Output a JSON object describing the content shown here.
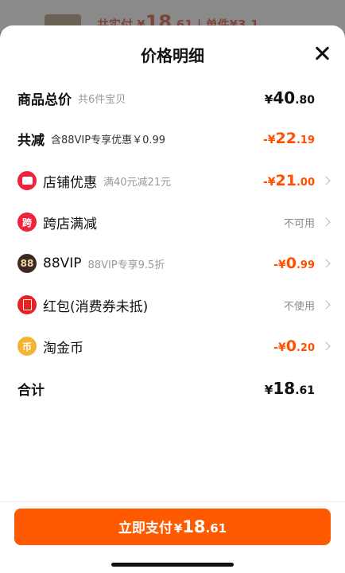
{
  "background": {
    "text_prefix": "共实付",
    "price_cur": "¥",
    "price_int": "18",
    "price_dec": ".61",
    "text_suffix": "| 单件¥3.1"
  },
  "sheet": {
    "title": "价格明细"
  },
  "rows": {
    "total": {
      "label": "商品总价",
      "sub": "共6件宝贝",
      "cur": "¥",
      "int": "40",
      "dec": ".80"
    },
    "reduce": {
      "label": "共减",
      "sub": "含88VIP专享优惠￥0.99",
      "cur": "-¥",
      "int": "22",
      "dec": ".19"
    },
    "store": {
      "label": "店铺优惠",
      "sub": "满40元减21元",
      "cur": "-¥",
      "int": "21",
      "dec": ".00"
    },
    "cross": {
      "icon_text": "跨",
      "label": "跨店满减",
      "value": "不可用"
    },
    "vip": {
      "icon_text": "88",
      "label": "88VIP",
      "sub": "88VIP专享9.5折",
      "cur": "-¥",
      "int": "0",
      "dec": ".99"
    },
    "redpacket": {
      "label": "红包(消费券未抵)",
      "value": "不使用"
    },
    "coin": {
      "icon_text": "币",
      "label": "淘金币",
      "cur": "-¥",
      "int": "0",
      "dec": ".20"
    },
    "sum": {
      "label": "合计",
      "cur": "¥",
      "int": "18",
      "dec": ".61"
    }
  },
  "pay_button": {
    "label": "立即支付",
    "cur": "¥",
    "int": "18",
    "dec": ".61"
  },
  "colors": {
    "accent": "#ff5000",
    "button": "#ff5a00",
    "red_icon": "#f0213a",
    "coin_icon": "#f3b531"
  }
}
